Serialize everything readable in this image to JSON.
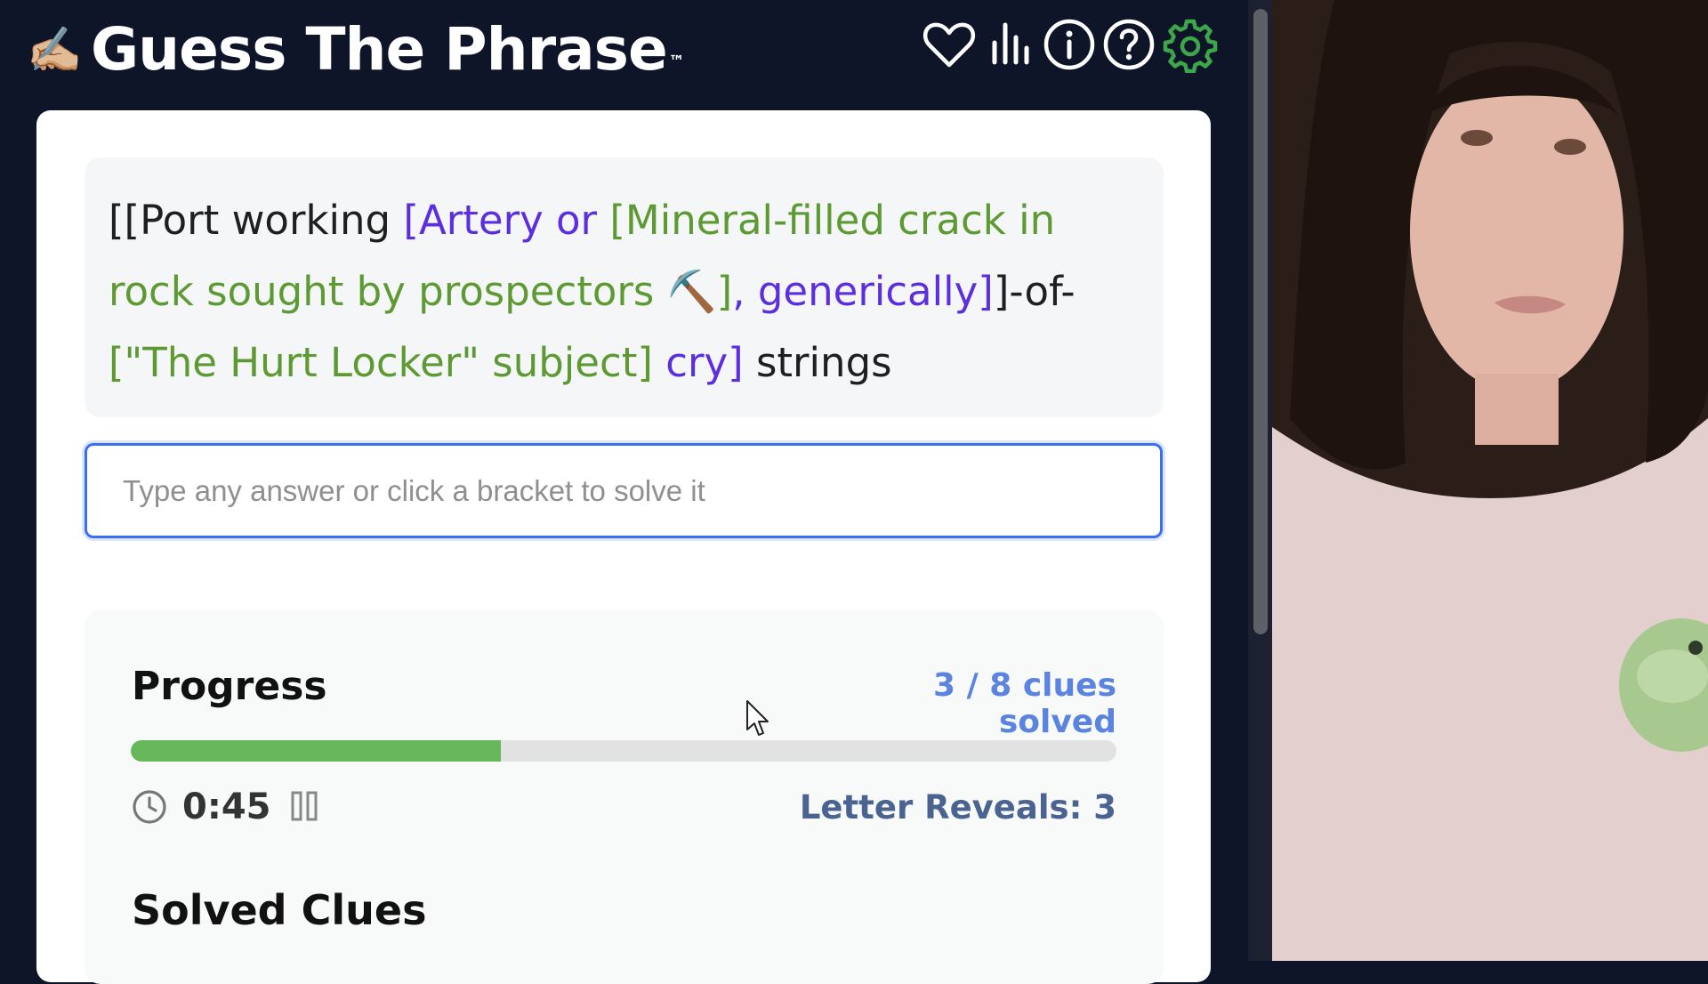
{
  "header": {
    "logo_emoji": "✍🏼",
    "title": "Guess The Phrase",
    "trademark": "™",
    "icons": [
      "heart-icon",
      "bar-chart-icon",
      "info-icon",
      "help-icon",
      "gear-icon"
    ],
    "settings_color": "#3ea64a"
  },
  "clue": {
    "parts": [
      {
        "text": "[[Port working ",
        "color": "dark"
      },
      {
        "text": "[Artery or ",
        "color": "purple"
      },
      {
        "text": "[Mineral-filled crack in rock sought by prospectors ⛏️]",
        "color": "green"
      },
      {
        "text": ", generically]",
        "color": "purple"
      },
      {
        "text": "]-of-",
        "color": "dark"
      },
      {
        "text": "[\"The Hurt Locker\" subject]",
        "color": "green"
      },
      {
        "text": " cry]",
        "color": "purple"
      },
      {
        "text": " strings",
        "color": "dark"
      }
    ]
  },
  "answer": {
    "placeholder": "Type any answer or click a bracket to solve it",
    "value": ""
  },
  "progress": {
    "title": "Progress",
    "solved_text": "3 / 8 clues solved",
    "solved": 3,
    "total": 8,
    "timer": "0:45",
    "letter_reveals": "Letter Reveals: 3"
  },
  "solved_clues": {
    "title": "Solved Clues"
  },
  "colors": {
    "purple": "#5b2ee0",
    "green": "#5e9a34",
    "progress_fill": "#67b85a",
    "accent_blue": "#3b6ef2"
  }
}
